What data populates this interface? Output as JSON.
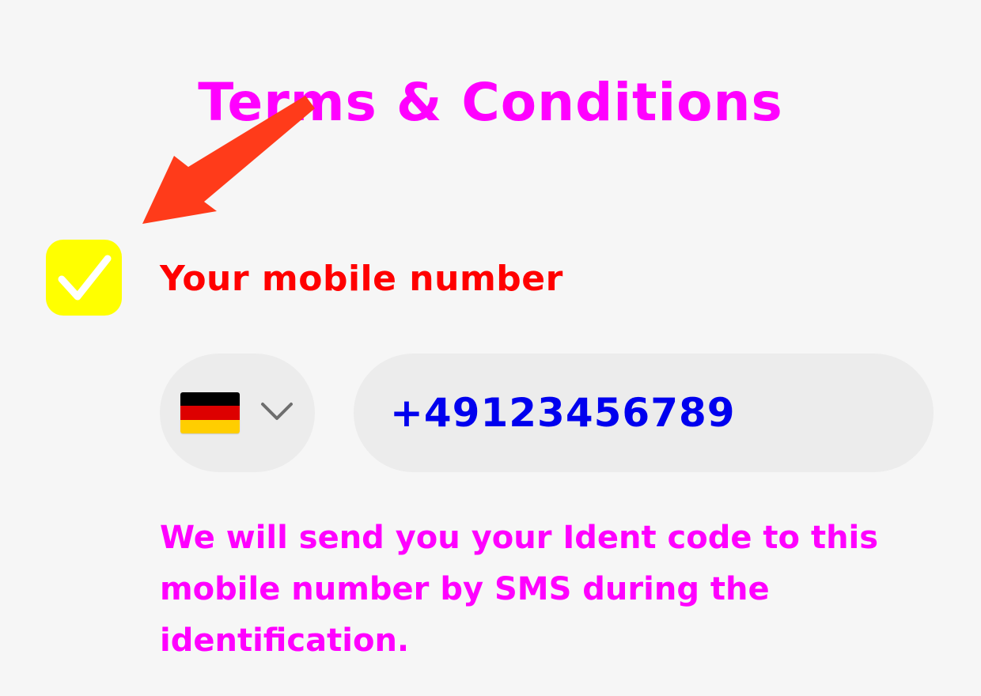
{
  "header": {
    "title": "Terms & Conditions",
    "title_color": "#ff00ff"
  },
  "consent": {
    "checked": true,
    "checkbox_color": "#ffff00",
    "checkmark_color": "#ffffff"
  },
  "annotation": {
    "arrow_color": "#ff3b1a"
  },
  "phone": {
    "label": "Your mobile number",
    "label_color": "#ff0000",
    "country": {
      "flag_icon": "germany-flag-icon",
      "flag_colors": [
        "#000000",
        "#dd0000",
        "#ffce00"
      ],
      "chevron_icon": "chevron-down-icon"
    },
    "value": "+49123456789",
    "value_color": "#0000ee",
    "field_background": "#ececec"
  },
  "hint": {
    "text": "We will send you your Ident code to this mobile number by SMS during the identification.",
    "color": "#ff00ff"
  }
}
